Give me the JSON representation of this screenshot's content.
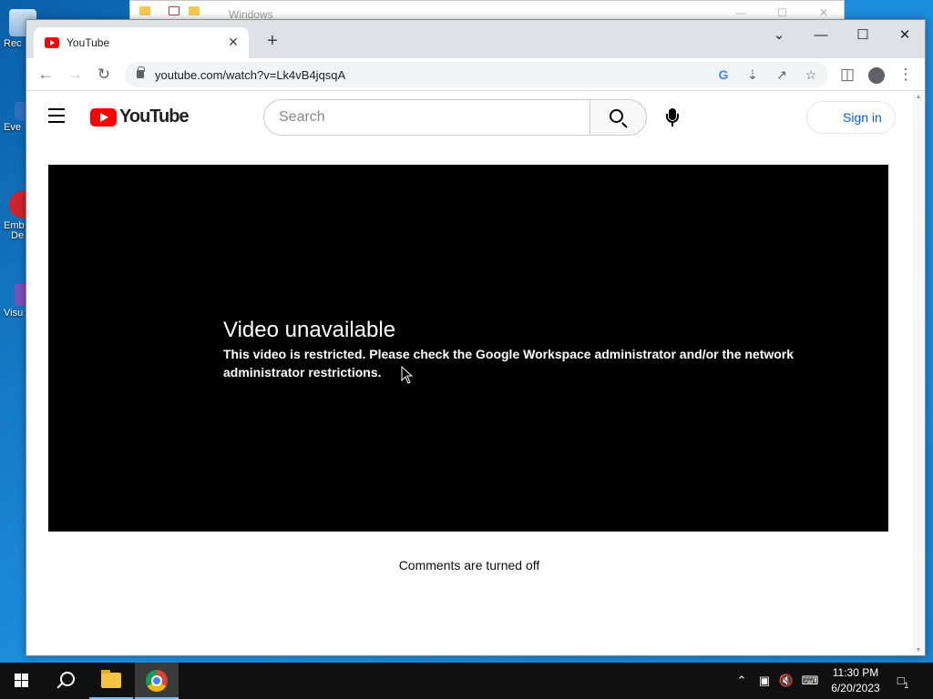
{
  "desktop": {
    "icons": [
      {
        "label": "Rec"
      },
      {
        "label": "Eve"
      },
      {
        "label": "Emb"
      },
      {
        "label": "De"
      },
      {
        "label": "Visu"
      }
    ]
  },
  "background_window": {
    "title": "Windows"
  },
  "browser": {
    "tab": {
      "title": "YouTube"
    },
    "new_tab_symbol": "+",
    "window_controls": {
      "dropdown": "⌄",
      "minimize": "—",
      "maximize": "☐",
      "close": "✕"
    },
    "address": {
      "url": "youtube.com/watch?v=Lk4vB4jqsqA"
    }
  },
  "youtube": {
    "logo_text": "YouTube",
    "search_placeholder": "Search",
    "signin_label": "Sign in",
    "error_title": "Video unavailable",
    "error_message": "This video is restricted. Please check the Google Workspace administrator and/or the network administrator restrictions.",
    "comments_status": "Comments are turned off"
  },
  "taskbar": {
    "time": "11:30 PM",
    "date": "6/20/2023",
    "notification_count": "1"
  },
  "colors": {
    "youtube_red": "#ff0000",
    "link_blue": "#065fd4",
    "taskbar_bg": "#101010"
  }
}
